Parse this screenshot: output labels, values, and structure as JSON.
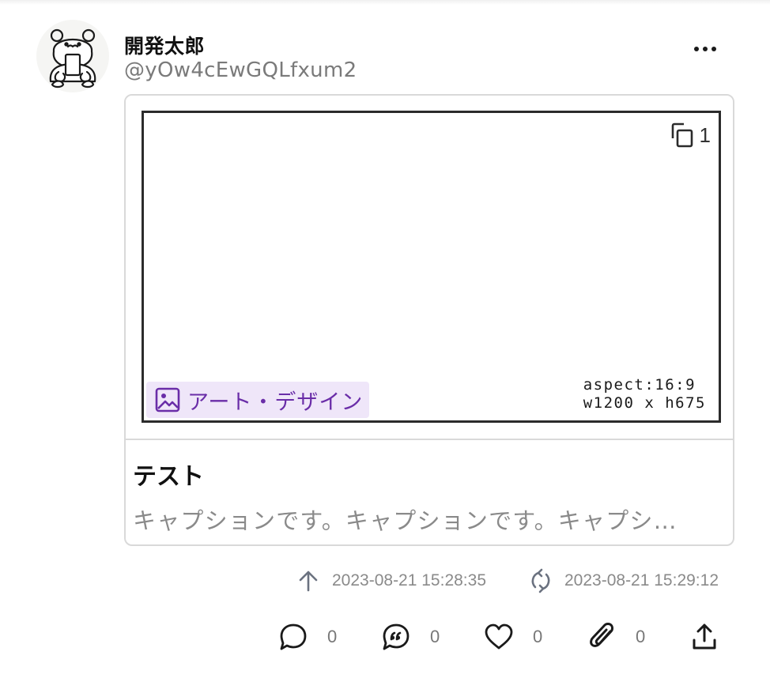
{
  "author": {
    "name": "開発太郎",
    "handle": "@yOw4cEwGQLfxum2",
    "avatar_icon": "bear-avatar-icon"
  },
  "menu": {
    "more_icon": "more-horizontal-icon"
  },
  "post": {
    "image_count": "1",
    "aspect_line1": "aspect:16:9",
    "aspect_line2": "w1200 x h675",
    "category": "アート・デザイン",
    "category_color": "#6a2da8",
    "category_bg": "#efe6f9",
    "title": "テスト",
    "caption": "キャプションです。キャプションです。キャプシ…"
  },
  "meta": {
    "posted_at": "2023-08-21 15:28:35",
    "updated_at": "2023-08-21 15:29:12"
  },
  "actions": {
    "comments": "0",
    "quotes": "0",
    "likes": "0",
    "clips": "0"
  }
}
